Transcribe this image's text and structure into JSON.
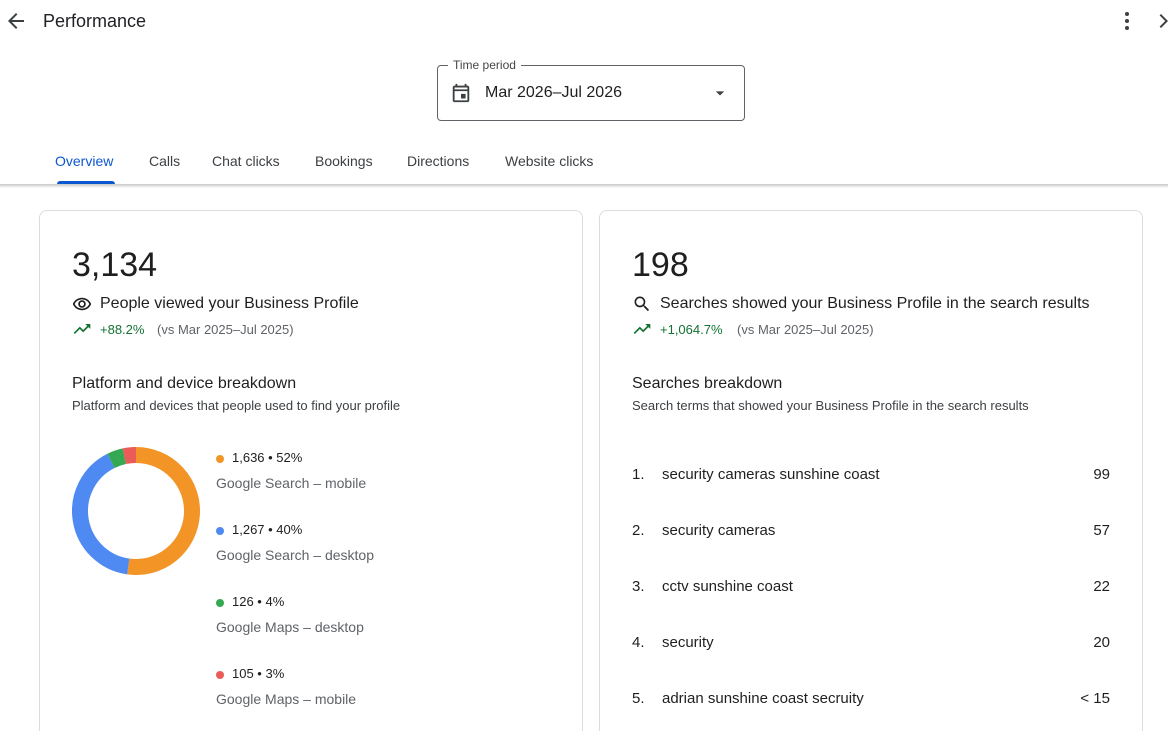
{
  "header": {
    "title": "Performance",
    "back_icon": "arrow-back-icon",
    "more_icon": "more-vert-icon",
    "next_icon": "chevron-right-icon"
  },
  "time_period": {
    "label": "Time period",
    "value": "Mar 2026–Jul 2026"
  },
  "tabs": [
    {
      "label": "Overview",
      "active": true
    },
    {
      "label": "Calls",
      "active": false
    },
    {
      "label": "Chat clicks",
      "active": false
    },
    {
      "label": "Bookings",
      "active": false
    },
    {
      "label": "Directions",
      "active": false
    },
    {
      "label": "Website clicks",
      "active": false
    }
  ],
  "views_card": {
    "total": "3,134",
    "label": "People viewed your Business Profile",
    "change": "+88.2%",
    "comparison": "(vs Mar 2025–Jul 2025)",
    "breakdown_title": "Platform and device breakdown",
    "breakdown_subtitle": "Platform and devices that people used to find your profile",
    "chart_data": {
      "type": "pie",
      "series": [
        {
          "name": "Google Search – mobile",
          "value": 1636,
          "percent": 52,
          "label": "1,636 • 52%",
          "color": "#f29426"
        },
        {
          "name": "Google Search – desktop",
          "value": 1267,
          "percent": 40,
          "label": "1,267 • 40%",
          "color": "#4f8af2"
        },
        {
          "name": "Google Maps – desktop",
          "value": 126,
          "percent": 4,
          "label": "126 • 4%",
          "color": "#34a853"
        },
        {
          "name": "Google Maps – mobile",
          "value": 105,
          "percent": 3,
          "label": "105 • 3%",
          "color": "#ea5c57"
        }
      ]
    }
  },
  "searches_card": {
    "total": "198",
    "label": "Searches showed your Business Profile in the search results",
    "change": "+1,064.7%",
    "comparison": "(vs Mar 2025–Jul 2025)",
    "breakdown_title": "Searches breakdown",
    "breakdown_subtitle": "Search terms that showed your Business Profile in the search results",
    "items": [
      {
        "rank": "1.",
        "term": "security cameras sunshine coast",
        "count": "99"
      },
      {
        "rank": "2.",
        "term": "security cameras",
        "count": "57"
      },
      {
        "rank": "3.",
        "term": "cctv sunshine coast",
        "count": "22"
      },
      {
        "rank": "4.",
        "term": "security",
        "count": "20"
      },
      {
        "rank": "5.",
        "term": "adrian sunshine coast secruity",
        "count": "< 15"
      }
    ]
  },
  "colors": {
    "accent": "#0b57d0",
    "positive": "#137333"
  }
}
